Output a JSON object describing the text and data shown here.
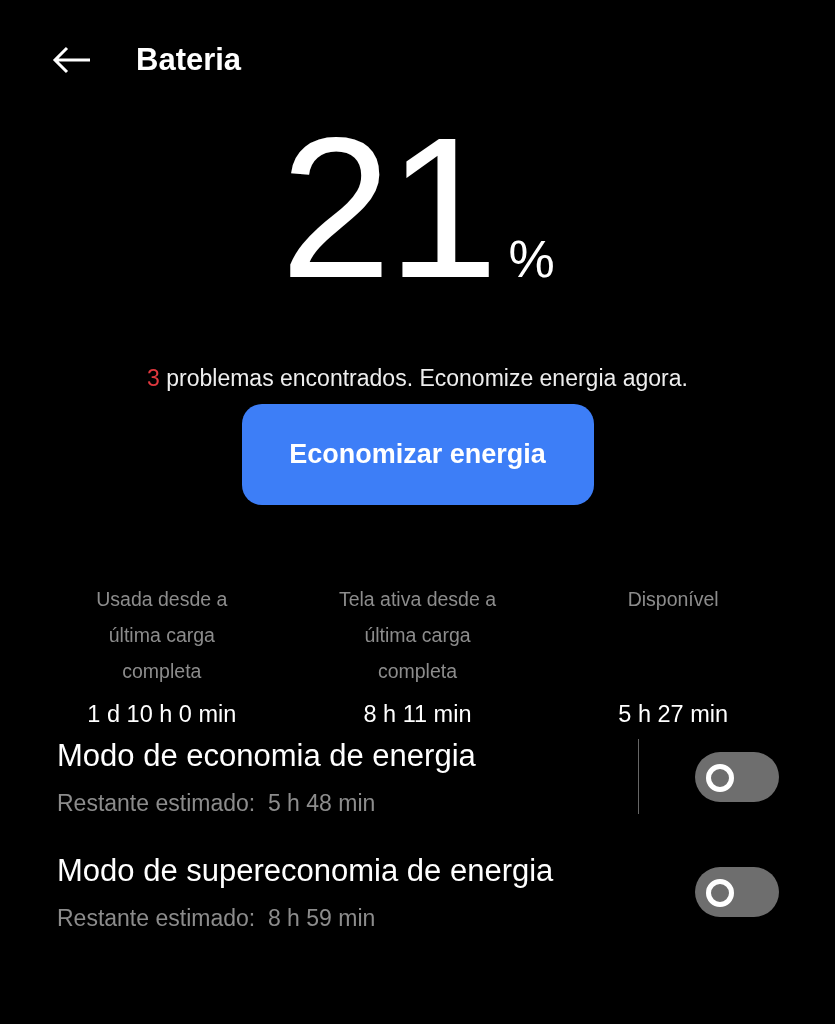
{
  "header": {
    "title": "Bateria"
  },
  "battery": {
    "value": "21",
    "unit": "%"
  },
  "problems": {
    "count": "3",
    "text": "problemas encontrados. Economize energia agora."
  },
  "action_button": {
    "label": "Economizar energia"
  },
  "stats": [
    {
      "label": "Usada desde a última carga completa",
      "value": "1 d 10 h 0 min"
    },
    {
      "label": "Tela ativa desde a última carga completa",
      "value": "8 h 11 min"
    },
    {
      "label": "Disponível",
      "value": "5 h 27 min"
    }
  ],
  "modes": [
    {
      "title": "Modo de economia de energia",
      "subtitle": "Restante estimado:  5 h 48 min",
      "on": false,
      "divider": true
    },
    {
      "title": "Modo de supereconomia de energia",
      "subtitle": "Restante estimado:  8 h 59 min",
      "on": false,
      "divider": false
    }
  ]
}
